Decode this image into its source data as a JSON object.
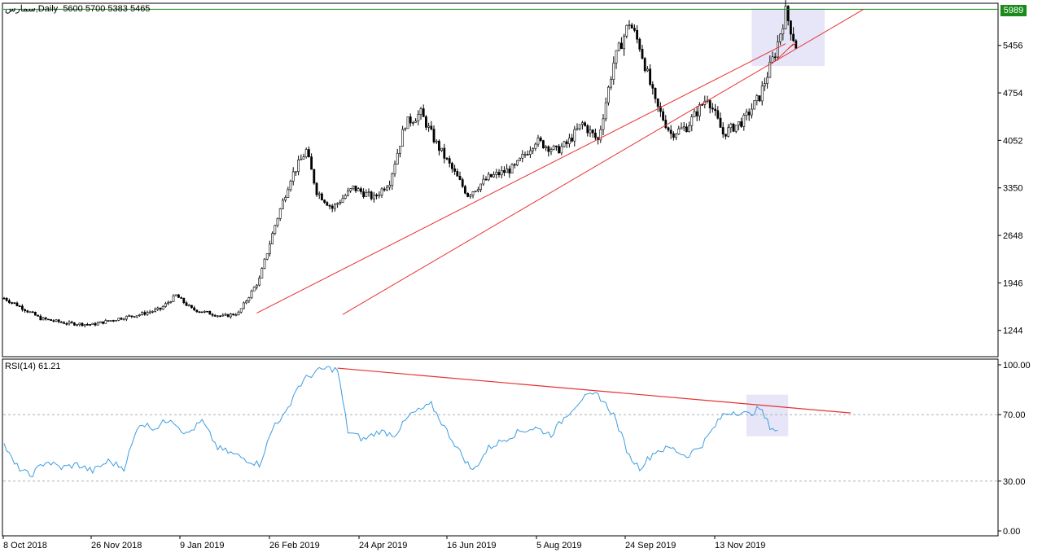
{
  "header": {
    "symbol": "سمارس",
    "timeframe": "Daily",
    "open": "5600",
    "high": "5700",
    "low": "5383",
    "close": "5465"
  },
  "current_price_tag": "5989",
  "rsi_header": {
    "label": "RSI(14)",
    "value": "61.21"
  },
  "chart_data": [
    {
      "type": "candlestick",
      "title": "",
      "y_tick_labels": [
        "5456",
        "4754",
        "4052",
        "3350",
        "2648",
        "1946",
        "1244"
      ],
      "ylim": [
        880,
        6030
      ],
      "x_tick_labels": [
        "8 Oct 2018",
        "26 Nov 2018",
        "9 Jan 2019",
        "26 Feb 2019",
        "24 Apr 2019",
        "16 Jun 2019",
        "5 Aug 2019",
        "24 Sep 2019",
        "13 Nov 2019"
      ],
      "price_line": 5989,
      "anchors": [
        [
          0,
          1720
        ],
        [
          6,
          1600
        ],
        [
          14,
          1420
        ],
        [
          24,
          1350
        ],
        [
          34,
          1330
        ],
        [
          44,
          1420
        ],
        [
          52,
          1480
        ],
        [
          60,
          1560
        ],
        [
          66,
          1760
        ],
        [
          72,
          1560
        ],
        [
          84,
          1450
        ],
        [
          90,
          1500
        ],
        [
          98,
          2000
        ],
        [
          104,
          2800
        ],
        [
          110,
          3500
        ],
        [
          116,
          3900
        ],
        [
          120,
          3300
        ],
        [
          126,
          3050
        ],
        [
          134,
          3350
        ],
        [
          142,
          3200
        ],
        [
          148,
          3450
        ],
        [
          154,
          4300
        ],
        [
          160,
          4450
        ],
        [
          166,
          4000
        ],
        [
          174,
          3500
        ],
        [
          178,
          3250
        ],
        [
          186,
          3500
        ],
        [
          196,
          3650
        ],
        [
          204,
          4050
        ],
        [
          212,
          3900
        ],
        [
          216,
          4000
        ],
        [
          222,
          4300
        ],
        [
          228,
          4050
        ],
        [
          234,
          5200
        ],
        [
          240,
          5800
        ],
        [
          244,
          5450
        ],
        [
          250,
          4600
        ],
        [
          256,
          4150
        ],
        [
          262,
          4250
        ],
        [
          270,
          4700
        ],
        [
          276,
          4150
        ],
        [
          284,
          4350
        ],
        [
          290,
          4700
        ],
        [
          296,
          5350
        ],
        [
          300,
          5950
        ],
        [
          304,
          5450
        ]
      ],
      "trendlines": [
        {
          "color": "#e83030",
          "points": [
            [
              97,
              1500
            ],
            [
              300,
              5480
            ]
          ]
        },
        {
          "color": "#e83030",
          "points": [
            [
              130,
              1480
            ],
            [
              330,
              5990
            ]
          ]
        },
        {
          "color": "#e83030",
          "points": [
            [
              296,
              5220
            ],
            [
              303,
              5480
            ]
          ]
        },
        {
          "color": "#e83030",
          "points": [
            [
              301,
              5410
            ],
            [
              304,
              5490
            ]
          ]
        }
      ],
      "highlight_box": {
        "x": [
          287,
          315
        ],
        "y": [
          5150,
          6000
        ],
        "color": "#e6e6f8"
      }
    },
    {
      "type": "line",
      "title": "",
      "name": "RSI(14)",
      "y_tick_labels": [
        "100.00",
        "70.00",
        "30.00",
        "0.00"
      ],
      "ylim": [
        0,
        100
      ],
      "levels": [
        70,
        30
      ],
      "x_tick_labels": [
        "8 Oct 2018",
        "26 Nov 2018",
        "9 Jan 2019",
        "26 Feb 2019",
        "24 Apr 2019",
        "16 Jun 2019",
        "5 Aug 2019",
        "24 Sep 2019",
        "13 Nov 2019"
      ],
      "line_color": "#3c9de0",
      "anchors": [
        [
          0,
          52
        ],
        [
          4,
          40
        ],
        [
          10,
          33
        ],
        [
          16,
          42
        ],
        [
          22,
          38
        ],
        [
          28,
          40
        ],
        [
          34,
          36
        ],
        [
          40,
          42
        ],
        [
          46,
          38
        ],
        [
          52,
          65
        ],
        [
          58,
          62
        ],
        [
          64,
          68
        ],
        [
          70,
          58
        ],
        [
          76,
          66
        ],
        [
          82,
          50
        ],
        [
          90,
          45
        ],
        [
          98,
          40
        ],
        [
          104,
          65
        ],
        [
          108,
          70
        ],
        [
          112,
          85
        ],
        [
          116,
          92
        ],
        [
          120,
          96
        ],
        [
          124,
          98
        ],
        [
          128,
          97
        ],
        [
          132,
          60
        ],
        [
          138,
          55
        ],
        [
          144,
          60
        ],
        [
          150,
          58
        ],
        [
          156,
          70
        ],
        [
          164,
          76
        ],
        [
          170,
          60
        ],
        [
          176,
          45
        ],
        [
          180,
          36
        ],
        [
          186,
          50
        ],
        [
          192,
          55
        ],
        [
          198,
          60
        ],
        [
          204,
          62
        ],
        [
          210,
          58
        ],
        [
          216,
          70
        ],
        [
          222,
          80
        ],
        [
          228,
          82
        ],
        [
          234,
          70
        ],
        [
          240,
          45
        ],
        [
          244,
          38
        ],
        [
          250,
          48
        ],
        [
          256,
          50
        ],
        [
          262,
          45
        ],
        [
          268,
          52
        ],
        [
          276,
          70
        ],
        [
          280,
          72
        ],
        [
          286,
          70
        ],
        [
          290,
          74
        ],
        [
          294,
          63
        ],
        [
          297,
          60
        ]
      ],
      "trendlines": [
        {
          "color": "#e83030",
          "points": [
            [
              128,
              98
            ],
            [
              325,
              71
            ]
          ]
        }
      ],
      "highlight_box": {
        "x": [
          285,
          301
        ],
        "y": [
          57,
          82
        ],
        "color": "#e6e6f8"
      }
    }
  ]
}
